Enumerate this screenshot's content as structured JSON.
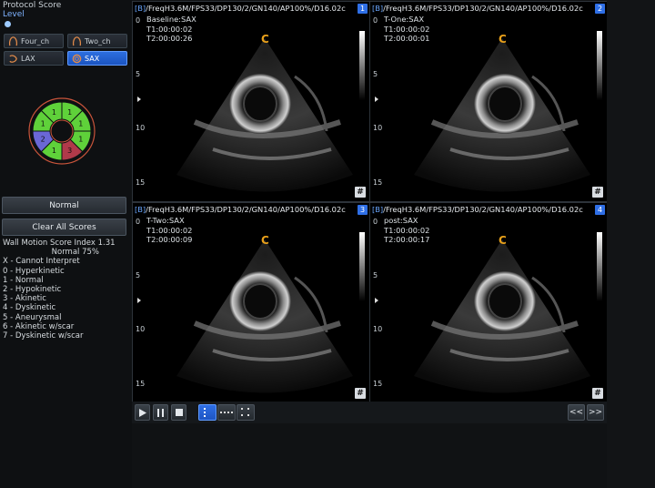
{
  "left_panel": {
    "protocol_label": "Protocol Score",
    "level_label": "Level",
    "view_buttons": [
      {
        "label": "Four_ch",
        "icon": "heart-four-chamber-icon",
        "active": false
      },
      {
        "label": "Two_ch",
        "icon": "heart-two-chamber-icon",
        "active": false
      },
      {
        "label": "LAX",
        "icon": "heart-lax-icon",
        "active": false
      },
      {
        "label": "SAX",
        "icon": "heart-sax-icon",
        "active": true
      }
    ],
    "bullseye_segments": [
      {
        "label": "1",
        "color": "#5fd13a"
      },
      {
        "label": "1",
        "color": "#5fd13a"
      },
      {
        "label": "1",
        "color": "#5fd13a"
      },
      {
        "label": "3",
        "color": "#b03a4a"
      },
      {
        "label": "1",
        "color": "#5fd13a"
      },
      {
        "label": "2",
        "color": "#6a67d6"
      },
      {
        "label": "1",
        "color": "#5fd13a"
      },
      {
        "label": "1",
        "color": "#5fd13a"
      }
    ],
    "normal_button": "Normal",
    "clear_button": "Clear All Scores",
    "wms_index": "Wall Motion Score Index 1.31",
    "normal_pct": "Normal 75%",
    "legend": [
      "X - Cannot Interpret",
      "0 - Hyperkinetic",
      "1 - Normal",
      "2 - Hypokinetic",
      "3 - Akinetic",
      "4 - Dyskinetic",
      "5 - Aneurysmal",
      "6 - Akinetic w/scar",
      "7 - Dyskinetic w/scar"
    ]
  },
  "panes": [
    {
      "number": "1",
      "prefix": "[B]",
      "header": "/FreqH3.6M/FPS33/DP130/2/GN140/AP100%/D16.02c",
      "stage": "Baseline:SAX",
      "t1": "T1:00:00:02",
      "t2": "T2:00:00:26"
    },
    {
      "number": "2",
      "prefix": "[B]",
      "header": "/FreqH3.6M/FPS33/DP130/2/GN140/AP100%/D16.02c",
      "stage": "T-One:SAX",
      "t1": "T1:00:00:02",
      "t2": "T2:00:00:01"
    },
    {
      "number": "3",
      "prefix": "[B]",
      "header": "/FreqH3.6M/FPS33/DP130/2/GN140/AP100%/D16.02c",
      "stage": "T-Two:SAX",
      "t1": "T1:00:00:02",
      "t2": "T2:00:00:09"
    },
    {
      "number": "4",
      "prefix": "[B]",
      "header": "/FreqH3.6M/FPS33/DP130/2/GN140/AP100%/D16.02c",
      "stage": "post:SAX",
      "t1": "T1:00:00:02",
      "t2": "T2:00:00:17"
    }
  ],
  "depth_scale": {
    "top": "0",
    "marks": [
      "5",
      "10",
      "15"
    ]
  },
  "orientation_marker": "C",
  "hash_button": "#",
  "playbar": {
    "play_icon": "play-icon",
    "pause_icon": "pause-icon",
    "stop_icon": "stop-icon",
    "prev_label": "<<",
    "next_label": ">>"
  }
}
